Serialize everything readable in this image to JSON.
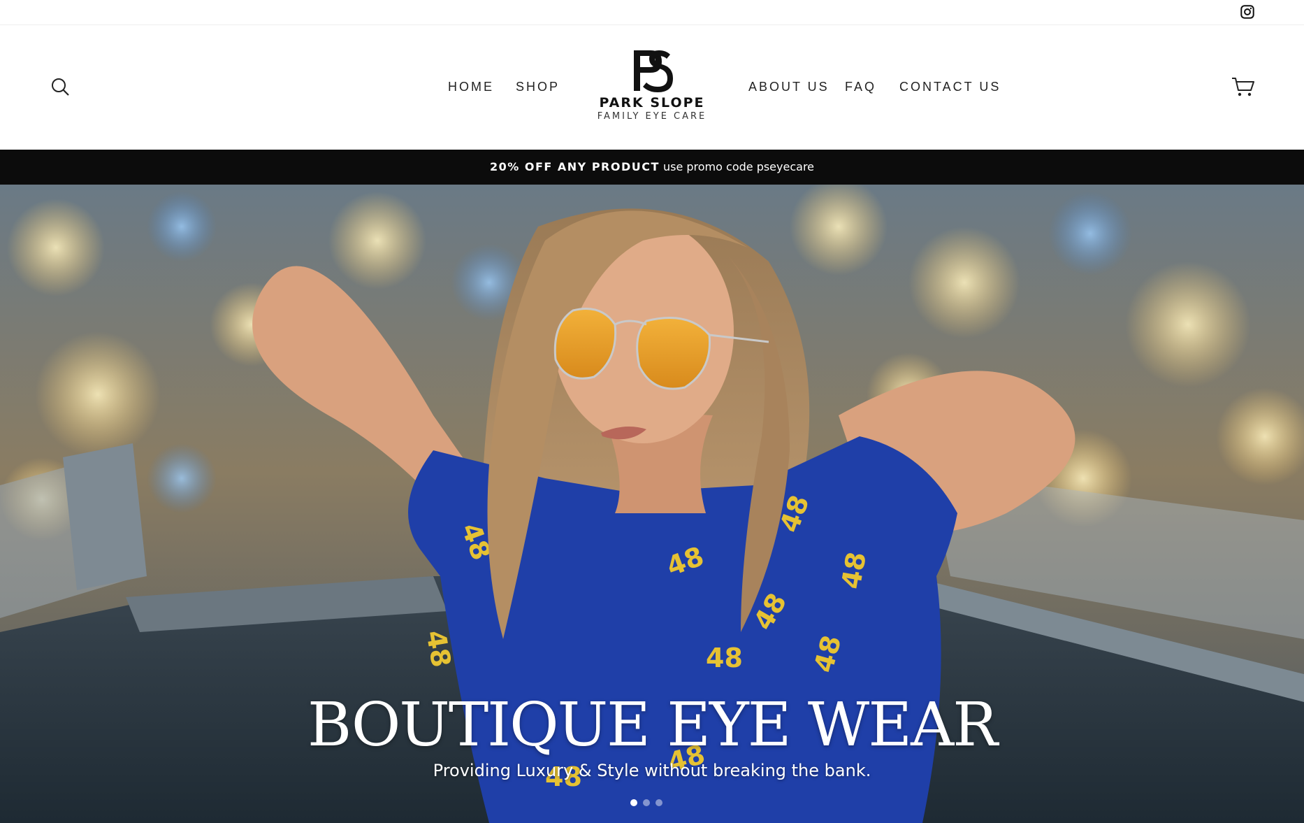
{
  "utility": {
    "instagram_icon": "instagram-icon"
  },
  "header": {
    "search_icon": "search-icon",
    "cart_icon": "cart-icon",
    "nav_left": [
      {
        "label": "HOME"
      },
      {
        "label": "SHOP"
      }
    ],
    "nav_right": [
      {
        "label": "ABOUT US"
      },
      {
        "label": "FAQ"
      },
      {
        "label": "CONTACT US"
      }
    ],
    "logo": {
      "monogram": "PS",
      "name": "PARK SLOPE",
      "subtitle": "FAMILY EYE CARE"
    }
  },
  "announcement": {
    "bold": "20% OFF ANY PRODUCT",
    "text": " use promo code pseyecare"
  },
  "hero": {
    "title": "BOUTIQUE EYE WEAR",
    "subtitle": "Providing Luxury & Style without breaking the bank.",
    "slides": 3,
    "active_slide": 1
  },
  "colors": {
    "announcement_bg": "#0c0c0c",
    "text_dark": "#222222",
    "shirt_blue": "#1f3fa8",
    "lens_amber": "#e8a020"
  }
}
